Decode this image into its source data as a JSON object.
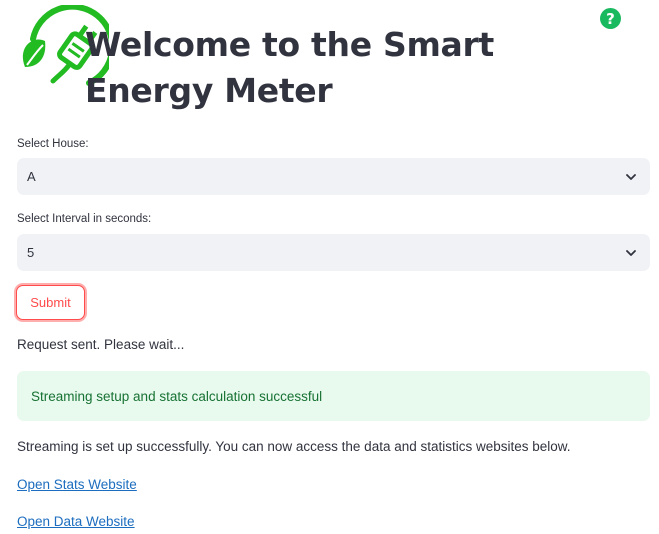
{
  "header": {
    "help_glyph": "?",
    "title": "Welcome to the Smart Energy Meter"
  },
  "house_select": {
    "label": "Select House:",
    "value": "A"
  },
  "interval_select": {
    "label": "Select Interval in seconds:",
    "value": "5"
  },
  "submit_button": {
    "label": "Submit"
  },
  "status": {
    "request": "Request sent. Please wait...",
    "success_alert": "Streaming setup and stats calculation successful",
    "info": "Streaming is set up successfully. You can now access the data and statistics websites below."
  },
  "links": {
    "stats": "Open Stats Website",
    "data": "Open Data Website"
  },
  "colors": {
    "accent_green": "#19b960",
    "primary_red": "#ff4b4b",
    "select_bg": "#f0f2f6",
    "success_bg": "#e8f9ee",
    "success_text": "#177233",
    "link": "#1c6dbf"
  },
  "icons": [
    "energy-plug-logo-icon",
    "help-icon",
    "chevron-down-icon"
  ]
}
